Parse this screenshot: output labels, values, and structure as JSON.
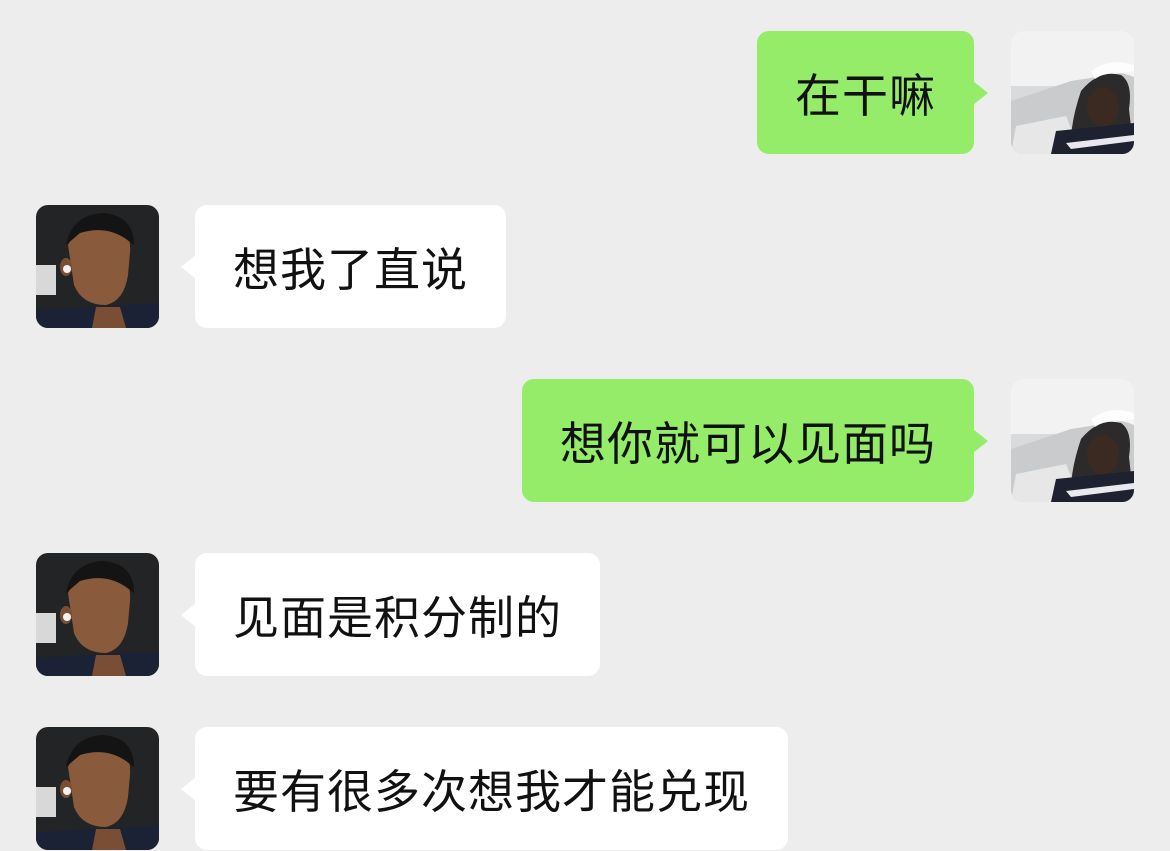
{
  "messages": [
    {
      "direction": "sent",
      "text": "在干嘛",
      "avatar": "self-avatar"
    },
    {
      "direction": "received",
      "text": "想我了直说",
      "avatar": "contact-avatar"
    },
    {
      "direction": "sent",
      "text": "想你就可以见面吗",
      "avatar": "self-avatar"
    },
    {
      "direction": "received",
      "text": "见面是积分制的",
      "avatar": "contact-avatar"
    },
    {
      "direction": "received",
      "text": "要有很多次想我才能兑现",
      "avatar": "contact-avatar"
    }
  ],
  "colors": {
    "background": "#ededed",
    "sent_bubble": "#95ec69",
    "received_bubble": "#ffffff",
    "text": "#111111"
  }
}
